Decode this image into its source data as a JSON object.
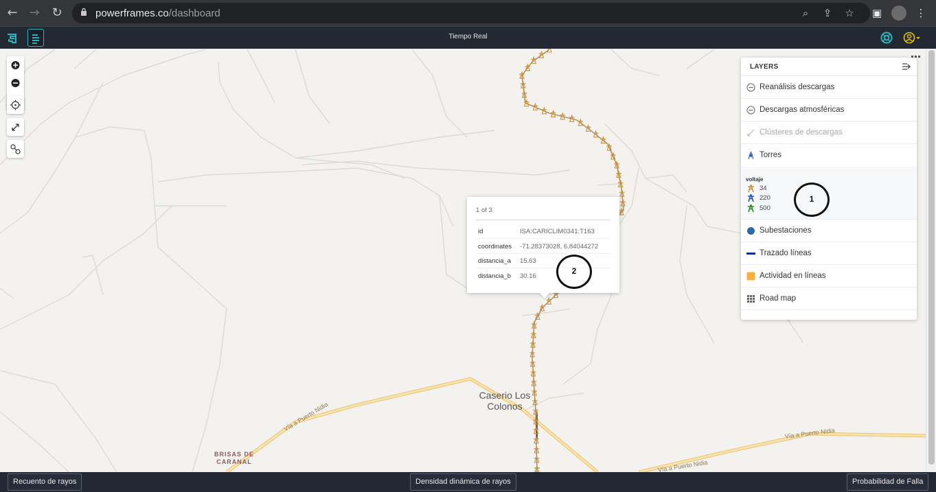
{
  "browser": {
    "domain": "powerframes.co",
    "path": "/dashboard"
  },
  "app": {
    "title": "Tiempo Real"
  },
  "layers": {
    "title": "LAYERS",
    "items": [
      {
        "label": "Reanálisis descargas",
        "icon": "minus-circle-icon"
      },
      {
        "label": "Descargas atmosféricas",
        "icon": "minus-circle-icon"
      },
      {
        "label": "Clústeres de descargas",
        "icon": "diagonal-arrow-icon",
        "disabled": true
      },
      {
        "label": "Torres",
        "icon": "tower-icon"
      },
      {
        "label": "Subestaciones",
        "icon": "blue-dot-icon",
        "color": "#2c6aa8"
      },
      {
        "label": "Trazado líneas",
        "icon": "blue-line-icon",
        "color": "#0b2f8a"
      },
      {
        "label": "Actividad en líneas",
        "icon": "orange-square-icon",
        "color": "#f8b040"
      },
      {
        "label": "Road map",
        "icon": "grid-icon"
      }
    ],
    "legend": {
      "title": "voltaje",
      "entries": [
        {
          "value": "34",
          "color": "#c8903c"
        },
        {
          "value": "220",
          "color": "#1f56b8"
        },
        {
          "value": "500",
          "color": "#2a8a2a"
        }
      ]
    }
  },
  "popup": {
    "count": "1 of 3",
    "rows": [
      {
        "key": "id",
        "value": "ISA:CARICLIM0341:T163"
      },
      {
        "key": "coordinates",
        "value": "-71.28373028, 6.84044272"
      },
      {
        "key": "distancia_a",
        "value": "15.63"
      },
      {
        "key": "distancia_b",
        "value": "30.16"
      }
    ]
  },
  "annotations": {
    "one": "1",
    "two": "2"
  },
  "map_labels": {
    "place": "Caserio Los Colonos",
    "town_line1": "BRISAS DE",
    "town_line2": "CARANAL",
    "road1": "Vía a Puerto Nidia",
    "road2": "Vía a Puerto Nidia",
    "road3": "Vía a Puerto Nidia"
  },
  "bottom": {
    "left_button": "Recuento de rayos",
    "center_button": "Densidad dinámica de rayos",
    "right_button": "Probabilidad de Falla"
  },
  "colors": {
    "header": "#232933",
    "accent": "#2bb3c0",
    "road": "#f8d58a",
    "tower": "#c8903c"
  }
}
